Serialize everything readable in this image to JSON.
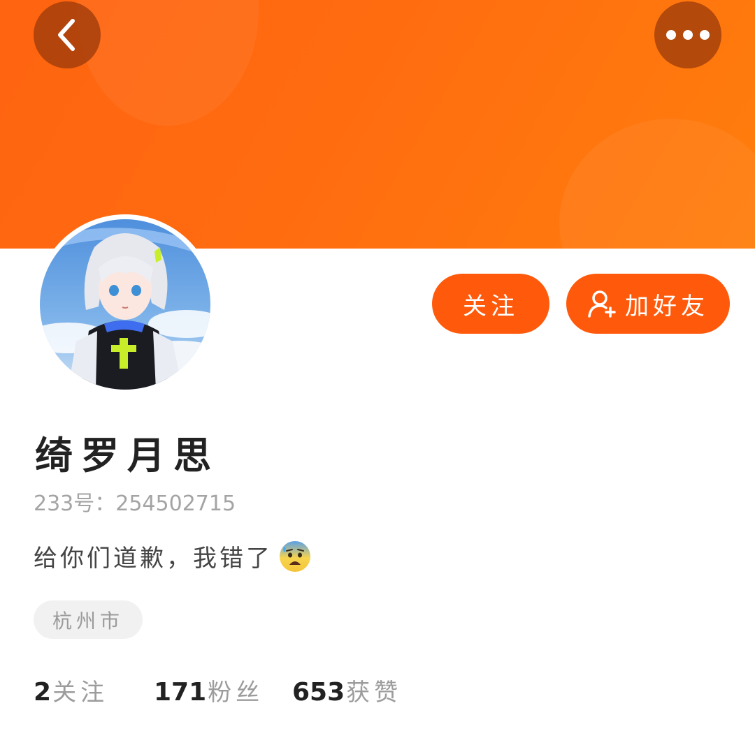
{
  "header": {
    "back_icon": "chevron-left-icon",
    "more_icon": "more-dots-icon",
    "banner_color": "#ff6a10"
  },
  "actions": {
    "follow_label": "关注",
    "add_friend_label": "加好友",
    "add_friend_icon": "add-user-icon",
    "accent_color": "#ff5a0c"
  },
  "profile": {
    "name": "绮罗月思",
    "account": "233号：254502715",
    "bio": "给你们道歉，我错了",
    "bio_emoji": "anxious-face-with-sweat-emoji",
    "location": "杭州市"
  },
  "stats": [
    {
      "value": "2",
      "label": "关注"
    },
    {
      "value": "171",
      "label": "粉丝"
    },
    {
      "value": "653",
      "label": "获赞"
    }
  ]
}
